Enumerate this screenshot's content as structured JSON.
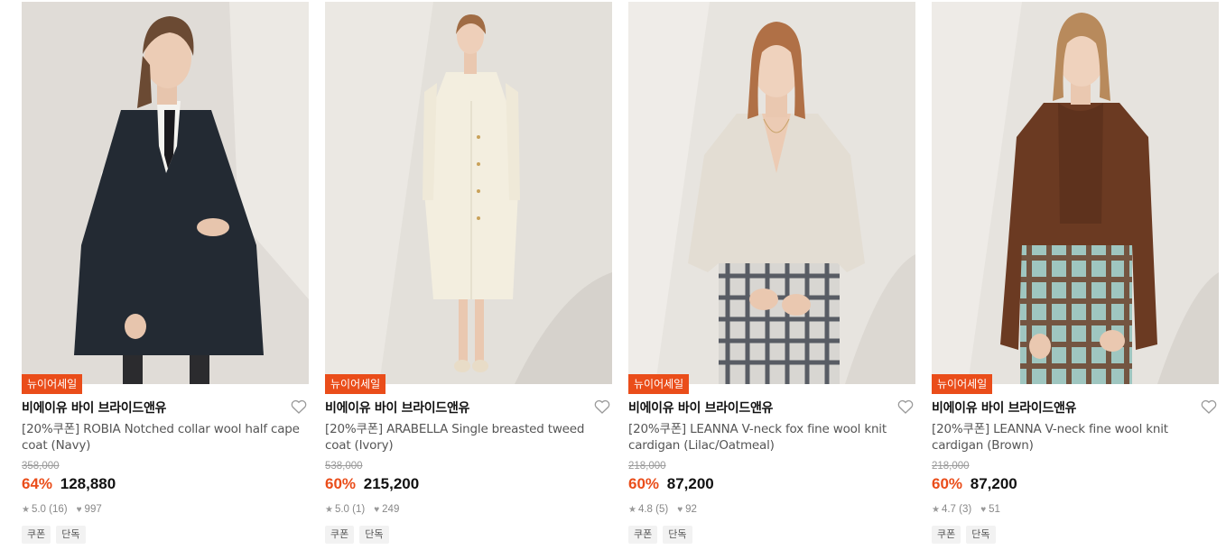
{
  "products": [
    {
      "badge": "뉴이어세일",
      "brand": "비에이유 바이 브라이드앤유",
      "title": "[20%쿠폰] ROBIA Notched collar wool half cape coat (Navy)",
      "original_price": "358,000",
      "discount": "64%",
      "price": "128,880",
      "rating": "5.0 (16)",
      "likes": "997",
      "tags": [
        "쿠폰",
        "단독"
      ],
      "colors": {
        "bg": "#e4e1dc",
        "garment": "#232a33",
        "accent": "#f4f3ef"
      }
    },
    {
      "badge": "뉴이어세일",
      "brand": "비에이유 바이 브라이드앤유",
      "title": "[20%쿠폰] ARABELLA Single breasted tweed coat (Ivory)",
      "original_price": "538,000",
      "discount": "60%",
      "price": "215,200",
      "rating": "5.0 (1)",
      "likes": "249",
      "tags": [
        "쿠폰",
        "단독"
      ],
      "colors": {
        "bg": "#e3e0da",
        "garment": "#f3eedf",
        "accent": "#ece5d2"
      }
    },
    {
      "badge": "뉴이어세일",
      "brand": "비에이유 바이 브라이드앤유",
      "title": "[20%쿠폰] LEANNA V-neck fox fine wool knit cardigan (Lilac/Oatmeal)",
      "original_price": "218,000",
      "discount": "60%",
      "price": "87,200",
      "rating": "4.8 (5)",
      "likes": "92",
      "tags": [
        "쿠폰",
        "단독"
      ],
      "colors": {
        "bg": "#e7e4df",
        "garment": "#e3ddd3",
        "accent": "#3b3f47"
      }
    },
    {
      "badge": "뉴이어세일",
      "brand": "비에이유 바이 브라이드앤유",
      "title": "[20%쿠폰] LEANNA V-neck fine wool knit cardigan (Brown)",
      "original_price": "218,000",
      "discount": "60%",
      "price": "87,200",
      "rating": "4.7 (3)",
      "likes": "51",
      "tags": [
        "쿠폰",
        "단독"
      ],
      "colors": {
        "bg": "#e6e3de",
        "garment": "#6b3a22",
        "accent": "#9fc6c0"
      }
    }
  ]
}
